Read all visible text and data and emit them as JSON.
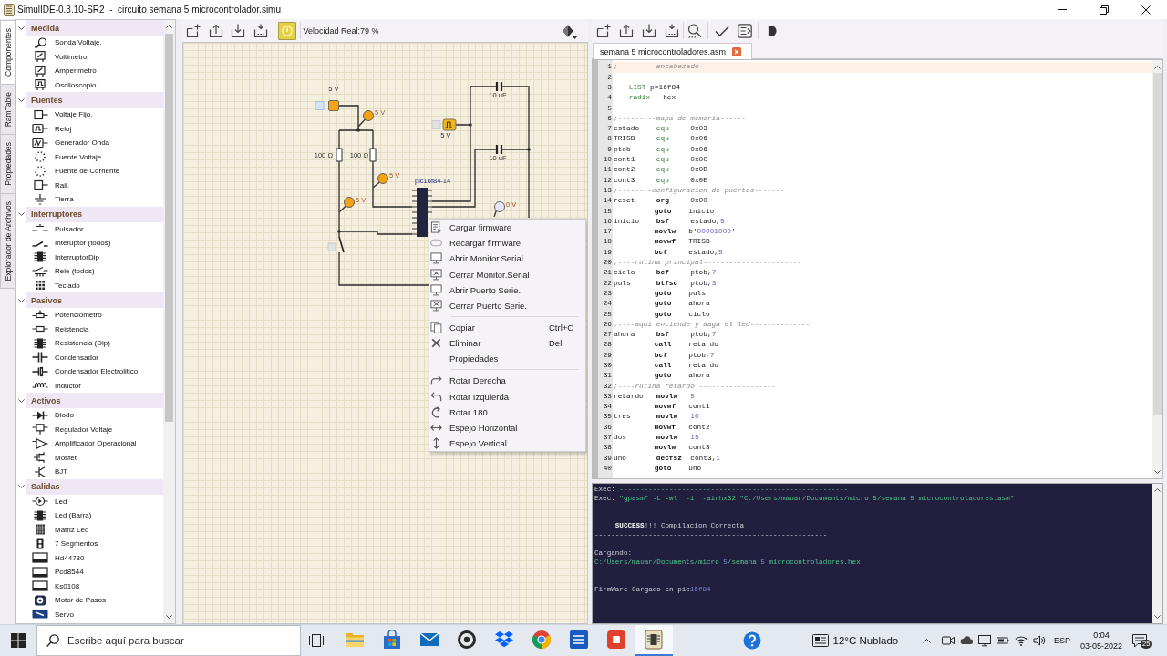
{
  "window": {
    "title": "SimulIDE-0.3.10-SR2  -  circuito semana 5 microcontrolador.simu"
  },
  "side_tabs": [
    {
      "label": "Componentes",
      "selected": true
    },
    {
      "label": "RamTable",
      "selected": false
    },
    {
      "label": "Propiedades",
      "selected": false
    },
    {
      "label": "Explorador de Archivos",
      "selected": false
    }
  ],
  "component_panel": {
    "categories": [
      {
        "label": "Medida",
        "expanded": true,
        "items": [
          "Sonda Voltaje.",
          "Voltimetro",
          "Amperimetro",
          "Osciloscopio"
        ]
      },
      {
        "label": "Fuentes",
        "expanded": true,
        "items": [
          "Voltaje Fijo.",
          "Reloj",
          "Generador Onda",
          "Fuente Voltaje",
          "Fuente de Corriente",
          "Rail.",
          "Tierra"
        ]
      },
      {
        "label": "Interruptores",
        "expanded": true,
        "items": [
          "Pulsador",
          "Interuptor (todos)",
          "InterruptorDip",
          "Rele (todos)",
          "Teclado"
        ]
      },
      {
        "label": "Pasivos",
        "expanded": true,
        "items": [
          "Potenciometro",
          "Reistencia",
          "Resistencia (Dip)",
          "Condensador",
          "Condensador Electrolitico",
          "Inductor"
        ]
      },
      {
        "label": "Activos",
        "expanded": true,
        "items": [
          "Diodo",
          "Regulador Voltaje",
          "Amplificador Operacional",
          "Mosfet",
          "BJT"
        ]
      },
      {
        "label": "Salidas",
        "expanded": true,
        "items": [
          "Led",
          "Led (Barra)",
          "Matriz Led",
          "7 Segmentos",
          "Hd44780",
          "Pcd8544",
          "Ks0108",
          "Motor de Pasos",
          "Servo"
        ]
      }
    ]
  },
  "circuit_toolbar": {
    "power_on": true,
    "speed": "Velocidad Real:79 %"
  },
  "circuit": {
    "parts": [
      {
        "kind": "fixed_voltage",
        "label": "5 V",
        "on": true
      },
      {
        "kind": "probe",
        "label": "5 V",
        "on": true
      },
      {
        "kind": "capacitor",
        "label": "10 uF"
      },
      {
        "kind": "clock",
        "label": "5 V"
      },
      {
        "kind": "resistor",
        "label": "100 Ω"
      },
      {
        "kind": "resistor",
        "label": "100 Ω"
      },
      {
        "kind": "capacitor",
        "label": "10 uF"
      },
      {
        "kind": "probe",
        "label": "5 V",
        "on": true
      },
      {
        "kind": "mcu",
        "label": "pic16f84-14"
      },
      {
        "kind": "probe",
        "label": "5 V",
        "on": true
      },
      {
        "kind": "probe",
        "label": "0 V",
        "on": false
      },
      {
        "kind": "switch",
        "on": false
      }
    ]
  },
  "context_menu": {
    "items": [
      {
        "kind": "action",
        "label": "Cargar firmware"
      },
      {
        "kind": "action",
        "label": "Recargar firmware"
      },
      {
        "kind": "action",
        "label": "Abrir Monitor.Serial"
      },
      {
        "kind": "action",
        "label": "Cerrar Monitor.Serial"
      },
      {
        "kind": "action",
        "label": "Abrir Puerto Serie."
      },
      {
        "kind": "action",
        "label": "Cerrar Puerto Serie."
      },
      {
        "kind": "separator"
      },
      {
        "kind": "action",
        "label": "Copiar",
        "shortcut": "Ctrl+C"
      },
      {
        "kind": "action",
        "label": "Eliminar",
        "shortcut": "Del"
      },
      {
        "kind": "action",
        "label": "Propiedades"
      },
      {
        "kind": "separator"
      },
      {
        "kind": "action",
        "label": "Rotar Derecha"
      },
      {
        "kind": "action",
        "label": "Rotar Izquierda"
      },
      {
        "kind": "action",
        "label": "Rotar 180"
      },
      {
        "kind": "action",
        "label": "Espejo Horizontal"
      },
      {
        "kind": "action",
        "label": "Espejo Vertical"
      }
    ]
  },
  "editor_tabs": [
    {
      "label": "semana 5 microcontroladores.asm",
      "selected": true
    }
  ],
  "editor": {
    "lines": [
      {
        "number": "1",
        "current": true,
        "segments": [
          {
            "kind": "comment",
            "text": ";---------encabezado-----------"
          }
        ]
      },
      {
        "number": "2",
        "current": false
      },
      {
        "number": "3",
        "current": false,
        "segments": [
          {
            "kind": "directive",
            "text": "    LIST"
          },
          {
            "kind": "plain",
            "text": " p=16f84"
          }
        ]
      },
      {
        "number": "4",
        "current": false,
        "segments": [
          {
            "kind": "directive",
            "text": "    radix"
          },
          {
            "kind": "plain",
            "text": "   hex"
          }
        ]
      },
      {
        "number": "5",
        "current": false
      },
      {
        "number": "6",
        "current": false,
        "segments": [
          {
            "kind": "comment",
            "text": ";---------mapa de memoria------"
          }
        ]
      },
      {
        "number": "7",
        "current": false,
        "segments": [
          {
            "kind": "plain",
            "text": "estado    "
          },
          {
            "kind": "directive",
            "text": "equ"
          },
          {
            "kind": "plain",
            "text": "     0x03"
          }
        ]
      },
      {
        "number": "8",
        "current": false,
        "segments": [
          {
            "kind": "plain",
            "text": "TRISB     "
          },
          {
            "kind": "directive",
            "text": "equ"
          },
          {
            "kind": "plain",
            "text": "     0x06"
          }
        ]
      },
      {
        "number": "9",
        "current": false,
        "segments": [
          {
            "kind": "plain",
            "text": "ptob      "
          },
          {
            "kind": "directive",
            "text": "equ"
          },
          {
            "kind": "plain",
            "text": "     0x06"
          }
        ]
      },
      {
        "number": "10",
        "current": false,
        "segments": [
          {
            "kind": "plain",
            "text": "cont1     "
          },
          {
            "kind": "directive",
            "text": "equ"
          },
          {
            "kind": "plain",
            "text": "     0x0C"
          }
        ]
      },
      {
        "number": "11",
        "current": false,
        "segments": [
          {
            "kind": "plain",
            "text": "cont2     "
          },
          {
            "kind": "directive",
            "text": "equ"
          },
          {
            "kind": "plain",
            "text": "     0x0D"
          }
        ]
      },
      {
        "number": "12",
        "current": false,
        "segments": [
          {
            "kind": "plain",
            "text": "cont3     "
          },
          {
            "kind": "directive",
            "text": "equ"
          },
          {
            "kind": "plain",
            "text": "     0x0E"
          }
        ]
      },
      {
        "number": "13",
        "current": false,
        "segments": [
          {
            "kind": "comment",
            "text": ";--------configuracion de puertos-------"
          }
        ]
      },
      {
        "number": "14",
        "current": false,
        "segments": [
          {
            "kind": "plain",
            "text": "reset     "
          },
          {
            "kind": "instruction",
            "text": "org"
          },
          {
            "kind": "plain",
            "text": "     0x00"
          }
        ]
      },
      {
        "number": "15",
        "current": false,
        "segments": [
          {
            "kind": "instruction",
            "text": "          goto"
          },
          {
            "kind": "plain",
            "text": "    inicio"
          }
        ]
      },
      {
        "number": "16",
        "current": false,
        "segments": [
          {
            "kind": "plain",
            "text": "inicio    "
          },
          {
            "kind": "instruction",
            "text": "bsf"
          },
          {
            "kind": "plain",
            "text": "     estado,"
          },
          {
            "kind": "number",
            "text": "5"
          }
        ]
      },
      {
        "number": "17",
        "current": false,
        "segments": [
          {
            "kind": "instruction",
            "text": "          movlw"
          },
          {
            "kind": "plain",
            "text": "   b'"
          },
          {
            "kind": "number",
            "text": "00001000"
          },
          {
            "kind": "plain",
            "text": "'"
          }
        ]
      },
      {
        "number": "18",
        "current": false,
        "segments": [
          {
            "kind": "instruction",
            "text": "          movwf"
          },
          {
            "kind": "plain",
            "text": "   TRISB"
          }
        ]
      },
      {
        "number": "19",
        "current": false,
        "segments": [
          {
            "kind": "instruction",
            "text": "          bcf"
          },
          {
            "kind": "plain",
            "text": "     estado,"
          },
          {
            "kind": "number",
            "text": "5"
          }
        ]
      },
      {
        "number": "20",
        "current": false,
        "segments": [
          {
            "kind": "comment",
            "text": ";----rutina principal-----------------------"
          }
        ]
      },
      {
        "number": "21",
        "current": false,
        "segments": [
          {
            "kind": "plain",
            "text": "ciclo     "
          },
          {
            "kind": "instruction",
            "text": "bcf"
          },
          {
            "kind": "plain",
            "text": "     ptob,"
          },
          {
            "kind": "number",
            "text": "7"
          }
        ]
      },
      {
        "number": "22",
        "current": false,
        "segments": [
          {
            "kind": "plain",
            "text": "puls      "
          },
          {
            "kind": "instruction",
            "text": "btfsc"
          },
          {
            "kind": "plain",
            "text": "   ptob,"
          },
          {
            "kind": "number",
            "text": "3"
          }
        ]
      },
      {
        "number": "23",
        "current": false,
        "segments": [
          {
            "kind": "instruction",
            "text": "          goto"
          },
          {
            "kind": "plain",
            "text": "    puls"
          }
        ]
      },
      {
        "number": "24",
        "current": false,
        "segments": [
          {
            "kind": "instruction",
            "text": "          goto"
          },
          {
            "kind": "plain",
            "text": "    ahora"
          }
        ]
      },
      {
        "number": "25",
        "current": false,
        "segments": [
          {
            "kind": "instruction",
            "text": "          goto"
          },
          {
            "kind": "plain",
            "text": "    ciclo"
          }
        ]
      },
      {
        "number": "26",
        "current": false,
        "segments": [
          {
            "kind": "comment",
            "text": ";----aqui enciende y aaga el led--------------"
          }
        ]
      },
      {
        "number": "27",
        "current": false,
        "segments": [
          {
            "kind": "plain",
            "text": "ahora     "
          },
          {
            "kind": "instruction",
            "text": "bsf"
          },
          {
            "kind": "plain",
            "text": "     ptob,"
          },
          {
            "kind": "number",
            "text": "7"
          }
        ]
      },
      {
        "number": "28",
        "current": false,
        "segments": [
          {
            "kind": "instruction",
            "text": "          call"
          },
          {
            "kind": "plain",
            "text": "    retardo"
          }
        ]
      },
      {
        "number": "29",
        "current": false,
        "segments": [
          {
            "kind": "instruction",
            "text": "          bcf"
          },
          {
            "kind": "plain",
            "text": "     ptob,"
          },
          {
            "kind": "number",
            "text": "7"
          }
        ]
      },
      {
        "number": "30",
        "current": false,
        "segments": [
          {
            "kind": "instruction",
            "text": "          call"
          },
          {
            "kind": "plain",
            "text": "    retardo"
          }
        ]
      },
      {
        "number": "31",
        "current": false,
        "segments": [
          {
            "kind": "instruction",
            "text": "          goto"
          },
          {
            "kind": "plain",
            "text": "    ahora"
          }
        ]
      },
      {
        "number": "32",
        "current": false,
        "segments": [
          {
            "kind": "comment",
            "text": ";----rutina retardo ------------------"
          }
        ]
      },
      {
        "number": "33",
        "current": false,
        "segments": [
          {
            "kind": "plain",
            "text": "retardo   "
          },
          {
            "kind": "instruction",
            "text": "movlw"
          },
          {
            "kind": "number",
            "text": "   5"
          }
        ]
      },
      {
        "number": "34",
        "current": false,
        "segments": [
          {
            "kind": "instruction",
            "text": "          movwf"
          },
          {
            "kind": "plain",
            "text": "   cont1"
          }
        ]
      },
      {
        "number": "35",
        "current": false,
        "segments": [
          {
            "kind": "plain",
            "text": "tres      "
          },
          {
            "kind": "instruction",
            "text": "movlw"
          },
          {
            "kind": "number",
            "text": "   10"
          }
        ]
      },
      {
        "number": "36",
        "current": false,
        "segments": [
          {
            "kind": "instruction",
            "text": "          movwf"
          },
          {
            "kind": "plain",
            "text": "   cont2"
          }
        ]
      },
      {
        "number": "37",
        "current": false,
        "segments": [
          {
            "kind": "plain",
            "text": "dos       "
          },
          {
            "kind": "instruction",
            "text": "movlw"
          },
          {
            "kind": "number",
            "text": "   15"
          }
        ]
      },
      {
        "number": "38",
        "current": false,
        "segments": [
          {
            "kind": "instruction",
            "text": "          movlw"
          },
          {
            "kind": "plain",
            "text": "   cont3"
          }
        ]
      },
      {
        "number": "39",
        "current": false,
        "segments": [
          {
            "kind": "plain",
            "text": "uno       "
          },
          {
            "kind": "instruction",
            "text": "decfsz"
          },
          {
            "kind": "plain",
            "text": "  cont3,"
          },
          {
            "kind": "number",
            "text": "1"
          }
        ]
      },
      {
        "number": "40",
        "current": false,
        "segments": [
          {
            "kind": "instruction",
            "text": "          goto"
          },
          {
            "kind": "plain",
            "text": "    uno"
          }
        ]
      }
    ]
  },
  "console": {
    "lines": [
      {
        "kind": "text",
        "segments": [
          {
            "kind": "plain",
            "text": "Exec: "
          },
          {
            "kind": "string",
            "text": "-------------------------------------------------------"
          }
        ]
      },
      {
        "kind": "text",
        "segments": [
          {
            "kind": "plain",
            "text": "Exec: "
          },
          {
            "kind": "string",
            "text": "\"gpasm\" -L -wl  -i  -ainhx32 \"C:/Users/mauar/Documents/micro 5/semana 5 microcontroladores.asm\""
          }
        ]
      },
      {
        "kind": "blank"
      },
      {
        "kind": "blank"
      },
      {
        "kind": "text",
        "segments": [
          {
            "kind": "keyword",
            "text": "     SUCCESS"
          },
          {
            "kind": "plain",
            "text": "!!! Compilacion Correcta"
          }
        ]
      },
      {
        "kind": "text",
        "segments": [
          {
            "kind": "plain",
            "text": "--------------------------------------------------------"
          }
        ]
      },
      {
        "kind": "blank"
      },
      {
        "kind": "text",
        "segments": [
          {
            "kind": "plain",
            "text": "Cargando:"
          }
        ]
      },
      {
        "kind": "text",
        "segments": [
          {
            "kind": "string",
            "text": "C:/Users/mauar/Documents/micro "
          },
          {
            "kind": "number",
            "text": "5"
          },
          {
            "kind": "string",
            "text": "/semana "
          },
          {
            "kind": "number",
            "text": "5"
          },
          {
            "kind": "string",
            "text": " microcontroladores.hex"
          }
        ]
      },
      {
        "kind": "blank"
      },
      {
        "kind": "blank"
      },
      {
        "kind": "text",
        "segments": [
          {
            "kind": "plain",
            "text": "FirmWare Cargado en pic"
          },
          {
            "kind": "number",
            "text": "16f84"
          }
        ]
      }
    ]
  },
  "taskbar": {
    "search": {
      "placeholder": "Escribe aquí para buscar"
    },
    "apps": [
      {
        "selected": false
      },
      {
        "selected": false
      },
      {
        "selected": false
      },
      {
        "selected": false
      },
      {
        "selected": false
      },
      {
        "selected": false
      },
      {
        "selected": false
      },
      {
        "selected": false
      },
      {
        "selected": true
      }
    ],
    "weather": "12°C Nublado",
    "language": "ESP",
    "time": "0:04",
    "date": "03-05-2022",
    "notifications": "25"
  }
}
